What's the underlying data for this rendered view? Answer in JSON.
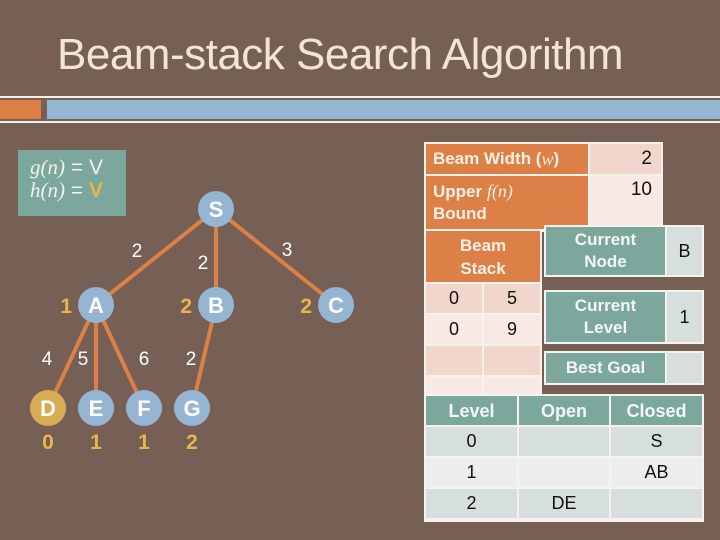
{
  "title": "Beam-stack Search Algorithm",
  "colors": {
    "background": "#765f55",
    "accent_orange": "#dd8047",
    "accent_blue": "#94b6d2",
    "teal": "#7ba79d",
    "highlight_yellow": "#e8b54d",
    "node_blue": "#94b6d2",
    "goal_node": "#d6ad55"
  },
  "formula": {
    "g_label": "g(n)",
    "g_eq": " = ",
    "g_val": "V",
    "h_label": "h(n)",
    "h_eq": " = ",
    "h_val": "V"
  },
  "tree": {
    "nodes": [
      {
        "id": "S",
        "h": ""
      },
      {
        "id": "A",
        "h": "1"
      },
      {
        "id": "B",
        "h": "2"
      },
      {
        "id": "C",
        "h": "2"
      },
      {
        "id": "D",
        "h": "0",
        "goal": true
      },
      {
        "id": "E",
        "h": "1"
      },
      {
        "id": "F",
        "h": "1"
      },
      {
        "id": "G",
        "h": "2"
      }
    ],
    "edges": [
      {
        "from": "S",
        "to": "A",
        "weight": "2"
      },
      {
        "from": "S",
        "to": "B",
        "weight": "2"
      },
      {
        "from": "S",
        "to": "C",
        "weight": "3"
      },
      {
        "from": "A",
        "to": "D",
        "weight": "4"
      },
      {
        "from": "A",
        "to": "E",
        "weight": "5"
      },
      {
        "from": "A",
        "to": "F",
        "weight": "6"
      },
      {
        "from": "B",
        "to": "G",
        "weight": "2"
      }
    ]
  },
  "params": {
    "beam_width_label": "Beam Width (",
    "beam_width_sym": "w",
    "beam_width_close": ")",
    "beam_width_value": "2",
    "upper_label": "Upper ",
    "upper_sym": "f(n)",
    "upper_label2": "Bound",
    "upper_value": "10"
  },
  "beam_stack": {
    "header": "Beam Stack",
    "rows": [
      [
        "0",
        "5"
      ],
      [
        "0",
        "9"
      ],
      [
        "",
        ""
      ],
      [
        "",
        ""
      ]
    ]
  },
  "status": {
    "current_node_label": "Current Node",
    "current_node_value": "B",
    "current_level_label": "Current Level",
    "current_level_value": "1",
    "best_goal_label": "Best Goal",
    "best_goal_value": ""
  },
  "levels": {
    "headers": [
      "Level",
      "Open",
      "Closed"
    ],
    "rows": [
      [
        "0",
        "",
        "S"
      ],
      [
        "1",
        "",
        "AB"
      ],
      [
        "2",
        "DE",
        ""
      ]
    ]
  }
}
